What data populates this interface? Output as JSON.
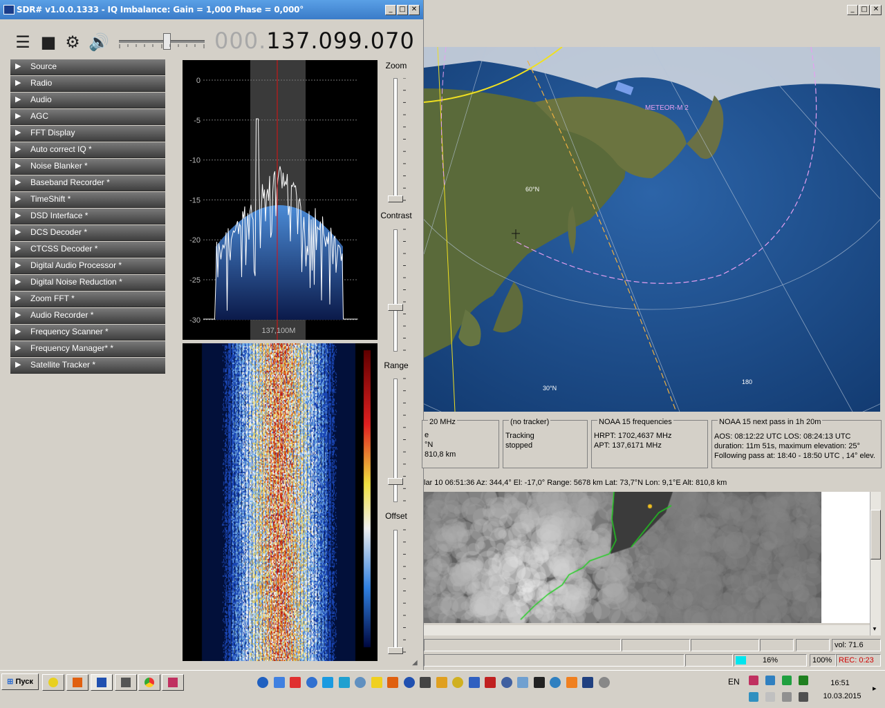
{
  "sdr": {
    "title": "SDR# v1.0.0.1333 - IQ Imbalance: Gain = 1,000 Phase = 0,000°",
    "freq_dim": "000.",
    "freq_main": "137.099.070",
    "panels": [
      "Source",
      "Radio",
      "Audio",
      "AGC",
      "FFT Display",
      "Auto correct IQ *",
      "Noise Blanker *",
      "Baseband Recorder *",
      "TimeShift *",
      "DSD Interface *",
      "DCS Decoder *",
      "CTCSS Decoder *",
      "Digital Audio Processor *",
      "Digital Noise Reduction *",
      "Zoom FFT *",
      "Audio Recorder *",
      "Frequency Scanner *",
      "Frequency Manager* *",
      "Satellite Tracker *"
    ],
    "spectrum": {
      "y_ticks": [
        "0",
        "-5",
        "-10",
        "-15",
        "-20",
        "-25",
        "-30"
      ],
      "center_label": "137,100M"
    },
    "sliders": {
      "zoom": "Zoom",
      "contrast": "Contrast",
      "range": "Range",
      "offset": "Offset"
    }
  },
  "tracker": {
    "map_labels": {
      "sat": "METEOR-M 2",
      "lat60": "60°N",
      "lat30": "30°N",
      "lon180": "180"
    },
    "box1": {
      "title": "20 MHz",
      "l1": "e",
      "l2": "°N",
      "l3": "810,8 km"
    },
    "box2": {
      "title": "(no tracker)",
      "l1": "Tracking",
      "l2": "stopped"
    },
    "box3": {
      "title": "NOAA 15 frequencies",
      "l1": "HRPT:  1702,4637 MHz",
      "l2": "APT:  137,6171 MHz"
    },
    "box4": {
      "title": "NOAA 15 next pass in 1h 20m",
      "l1": "AOS: 08:12:22 UTC  LOS: 08:24:13 UTC",
      "l2": "duration: 11m 51s,  maximum elevation: 25°",
      "l3": "Following pass at: 18:40 - 18:50 UTC , 14° elev."
    },
    "status": "lar 10  06:51:36  Az: 344,4°  El: -17,0°  Range: 5678 km  Lat: 73,7°N  Lon: 9,1°E  Alt: 810,8 km",
    "vol": "vol: 71.6",
    "pct": "16%",
    "zoom_pct": "100%",
    "rec": "REC: 0:23"
  },
  "taskbar": {
    "start": "Пуск",
    "lang": "EN",
    "time": "16:51",
    "date": "10.03.2015"
  },
  "colors": {
    "title_blue": "#3a7bc8",
    "rec_red": "#d00000",
    "progress_cyan": "#00e5ee"
  }
}
